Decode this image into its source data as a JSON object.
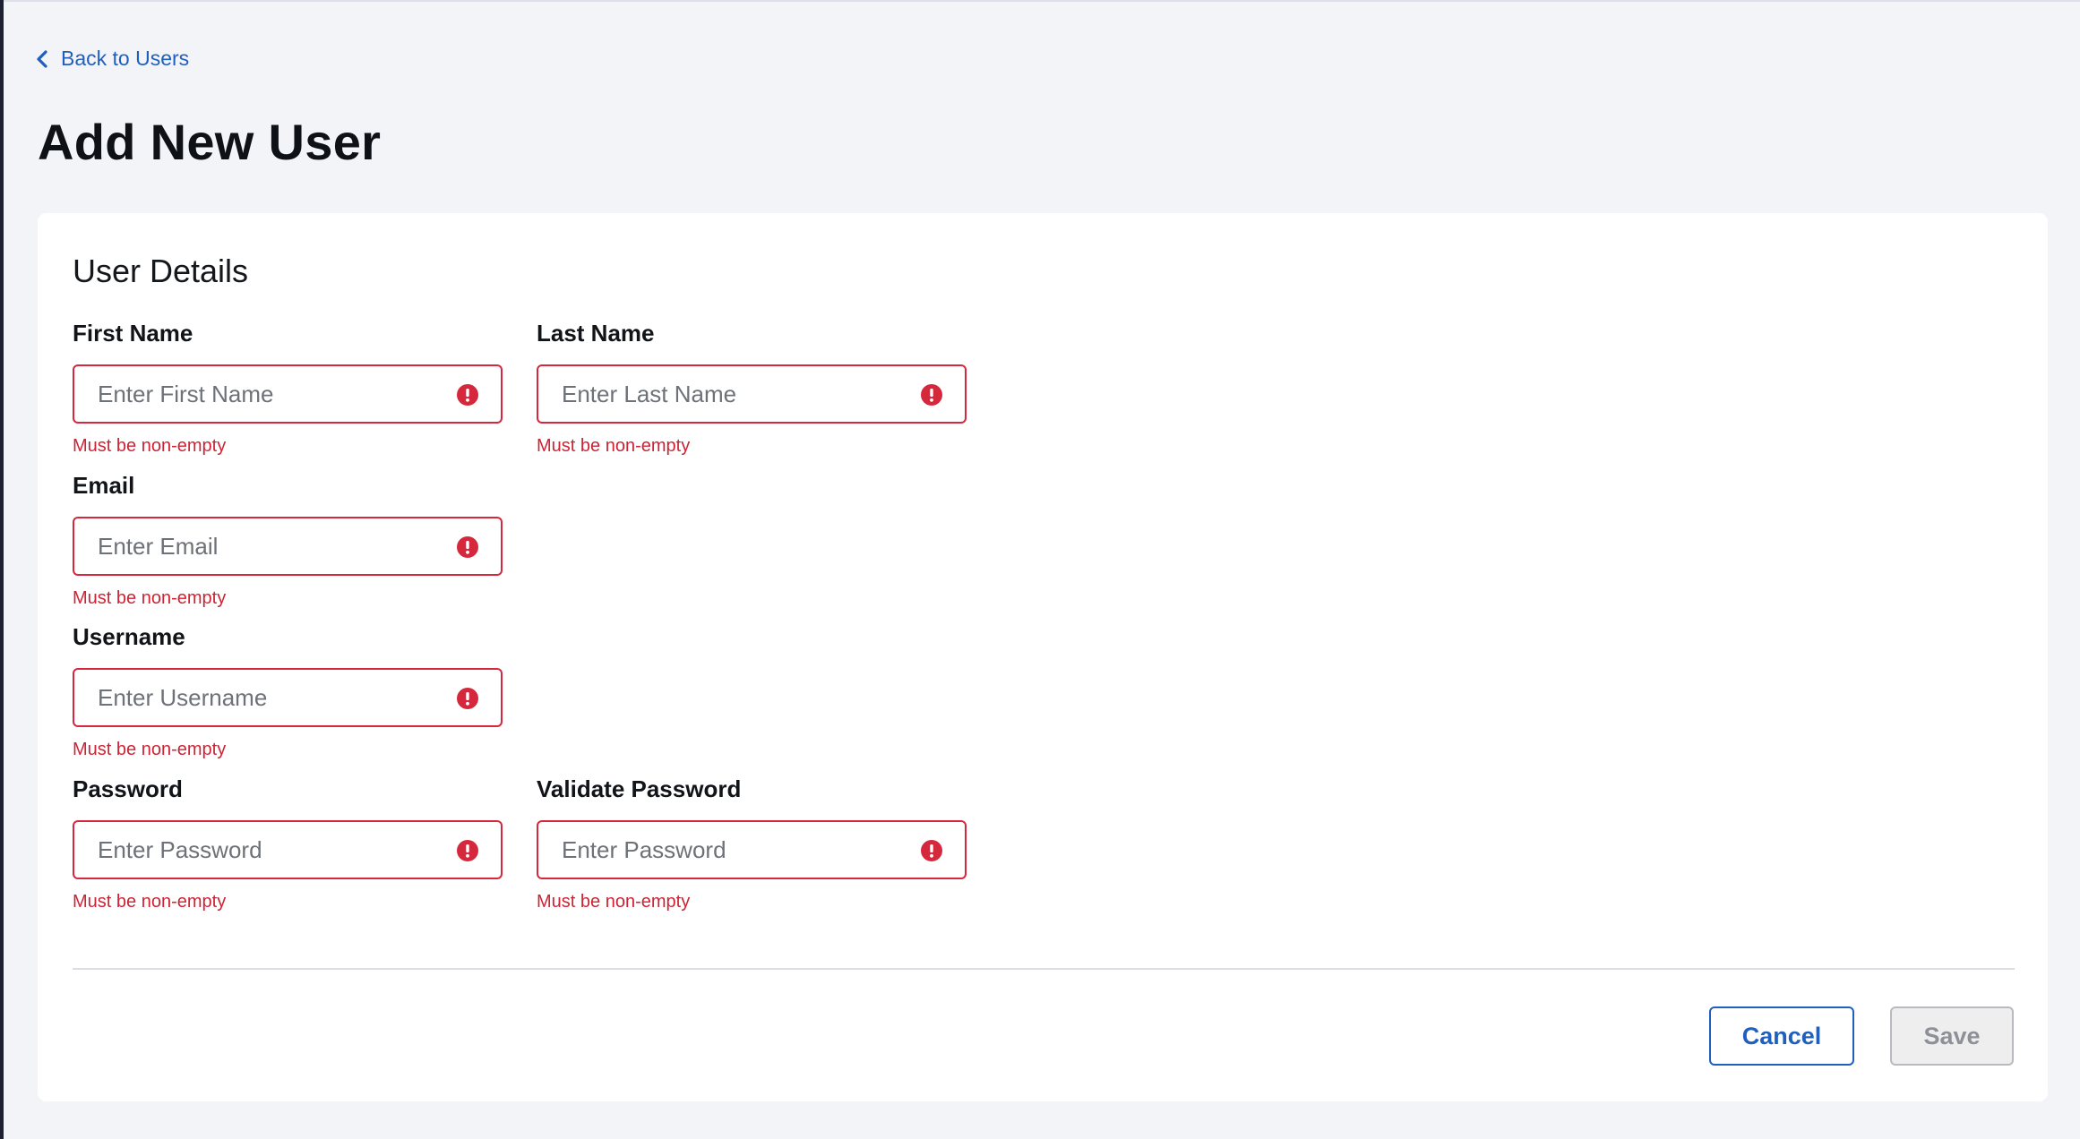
{
  "nav": {
    "back_label": "Back to Users"
  },
  "page": {
    "title": "Add New User"
  },
  "form": {
    "section_title": "User Details",
    "fields": {
      "first_name": {
        "label": "First Name",
        "placeholder": "Enter First Name",
        "value": "",
        "error": "Must be non-empty"
      },
      "last_name": {
        "label": "Last Name",
        "placeholder": "Enter Last Name",
        "value": "",
        "error": "Must be non-empty"
      },
      "email": {
        "label": "Email",
        "placeholder": "Enter Email",
        "value": "",
        "error": "Must be non-empty"
      },
      "username": {
        "label": "Username",
        "placeholder": "Enter Username",
        "value": "",
        "error": "Must be non-empty"
      },
      "password": {
        "label": "Password",
        "placeholder": "Enter Password",
        "value": "",
        "error": "Must be non-empty"
      },
      "validate_password": {
        "label": "Validate Password",
        "placeholder": "Enter Password",
        "value": "",
        "error": "Must be non-empty"
      }
    }
  },
  "actions": {
    "cancel_label": "Cancel",
    "save_label": "Save",
    "save_disabled": true
  },
  "icons": {
    "back": "chevron-left-icon",
    "field_error": "error-circle-icon"
  },
  "colors": {
    "accent": "#1f5fbf",
    "error": "#d6283d",
    "background": "#f3f4f8",
    "card": "#ffffff"
  }
}
